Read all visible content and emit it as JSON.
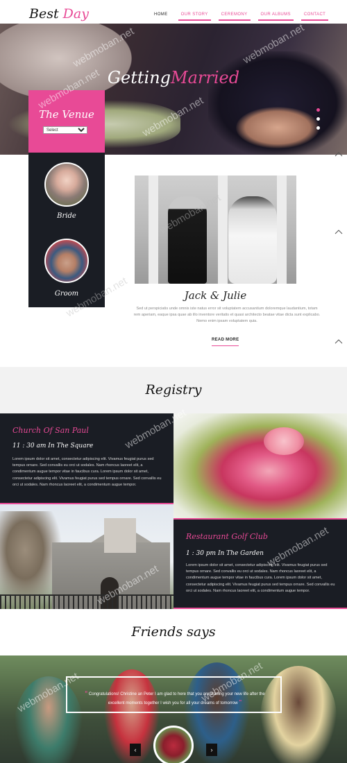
{
  "header": {
    "logo_part1": "Best",
    "logo_part2": "Day",
    "nav": [
      "HOME",
      "OUR STORY",
      "CEREMONY",
      "OUR ALBUMS",
      "CONTACT"
    ]
  },
  "hero": {
    "title_part1": "Getting",
    "title_part2": "Married",
    "slide_dots": 3,
    "active_slide": 1
  },
  "venue": {
    "title": "The Venue",
    "select_value": "Select"
  },
  "couple": {
    "bride_label": "Bride",
    "groom_label": "Groom",
    "names": "Jack & Julie",
    "bio": "Sed ut perspiciatis unde omnis iste natus error sit voluptatem accusantium doloremque laudantium, totam rem aperiam, eaque ipsa quae ab illo inventore veritatis et quasi architecto beatae vitae dicta sunt explicabo. Nemo enim ipsam voluptatem quia.",
    "read_more": "READ MORE"
  },
  "registry": {
    "title": "Registry",
    "events": [
      {
        "name": "Church Of San Paul",
        "time": "11 : 30 am In The Square",
        "text": "Lorem ipsum dolor sit amet, consectetur adipiscing elit. Vivamus feugiat purus sed tempus ornare. Sed convallis eu orci ut sodales. Nam rhoncus laoreet elit, a condimentum augue tempor vitae in faucibus cura. Lorem ipsum dolor sit amet, consectetur adipiscing elit. Vivamus feugiat purus sed tempus ornare. Sed convallis eu orci ut sodales. Nam rhoncus laoreet elit, a condimentum augue tempor."
      },
      {
        "name": "Restaurant Golf Club",
        "time": "1 : 30 pm In The Garden",
        "text": "Lorem ipsum dolor sit amet, consectetur adipiscing elit. Vivamus feugiat purus sed tempus ornare. Sed convallis eu orci ut sodales. Nam rhoncus laoreet elit, a condimentum augue tempor vitae in faucibus cura. Lorem ipsum dolor sit amet, consectetur adipiscing elit. Vivamus feugiat purus sed tempus ornare. Sed convallis eu orci ut sodales. Nam rhoncus laoreet elit, a condimentum augue tempor."
      }
    ]
  },
  "friends": {
    "title": "Friends says",
    "quote": "Congratulations! Christine an Peter I am glad to here that you are starting your new life after the excellent moments together I wish you for all your dreams of tomorrow",
    "prev": "‹",
    "next": "›"
  },
  "watermark": "webmoban.net",
  "colors": {
    "accent": "#e84a96",
    "dark_panel": "#1a1d24",
    "light_band": "#f2f2f2"
  }
}
